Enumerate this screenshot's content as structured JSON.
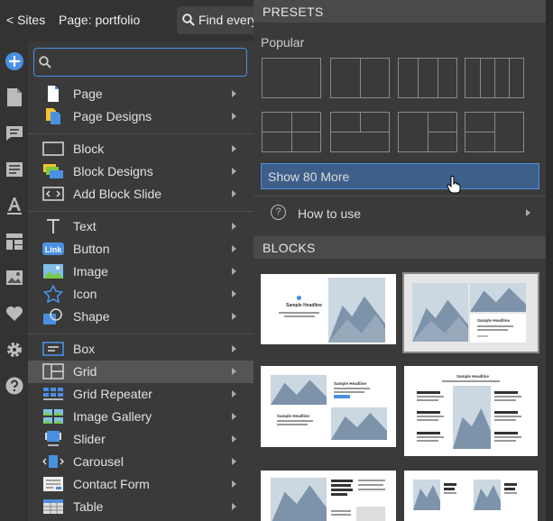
{
  "topbar": {
    "sites_label": "< Sites",
    "page_label": "Page: portfolio",
    "find_label": "Find every"
  },
  "search": {
    "placeholder": "",
    "value": ""
  },
  "menu": {
    "items": [
      {
        "label": "Page"
      },
      {
        "label": "Page Designs"
      },
      {
        "label": "Block"
      },
      {
        "label": "Block Designs"
      },
      {
        "label": "Add Block Slide"
      },
      {
        "label": "Text"
      },
      {
        "label": "Button"
      },
      {
        "label": "Image"
      },
      {
        "label": "Icon"
      },
      {
        "label": "Shape"
      },
      {
        "label": "Box"
      },
      {
        "label": "Grid",
        "active": true
      },
      {
        "label": "Grid Repeater"
      },
      {
        "label": "Image Gallery"
      },
      {
        "label": "Slider"
      },
      {
        "label": "Carousel"
      },
      {
        "label": "Contact Form"
      },
      {
        "label": "Table"
      }
    ],
    "link_icon_text": "Link"
  },
  "panel": {
    "presets_title": "PRESETS",
    "popular_label": "Popular",
    "show_more_label": "Show 80 More",
    "how_to_label": "How to use",
    "blocks_title": "BLOCKS",
    "thumb_heading": "Sample Headline"
  },
  "colors": {
    "accent": "#4a90e2",
    "active_row": "#555555",
    "show_more_bg": "#3e5f8a"
  }
}
